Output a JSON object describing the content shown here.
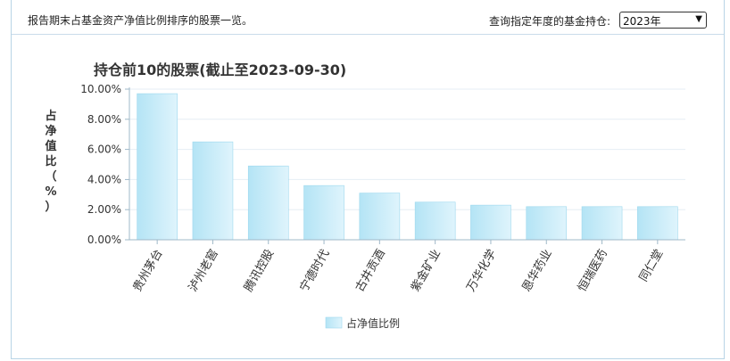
{
  "header": {
    "description": "报告期末占基金资产净值比例排序的股票一览。",
    "query_label": "查询指定年度的基金持仓:",
    "year_selected": "2023年"
  },
  "chart_data": {
    "type": "bar",
    "title": "持仓前10的股票(截止至2023-09-30)",
    "ylabel": "占净值比（%）",
    "ylim": [
      0,
      10
    ],
    "yticks": [
      "0.00%",
      "2.00%",
      "4.00%",
      "6.00%",
      "8.00%",
      "10.00%"
    ],
    "categories": [
      "贵州茅台",
      "泸州老窖",
      "腾讯控股",
      "宁德时代",
      "古井贡酒",
      "紫金矿业",
      "万华化学",
      "恩华药业",
      "恒瑞医药",
      "同仁堂"
    ],
    "series": [
      {
        "name": "占净值比例",
        "values": [
          9.7,
          6.5,
          4.9,
          3.6,
          3.1,
          2.5,
          2.3,
          2.2,
          2.2,
          2.2
        ]
      }
    ],
    "colors": {
      "bar": "#c6ecf8",
      "bar_edge": "#9dd8ee",
      "axis": "#9fb8c8",
      "grid": "#e6eef4"
    },
    "legend": "bottom-center",
    "grid": true
  }
}
